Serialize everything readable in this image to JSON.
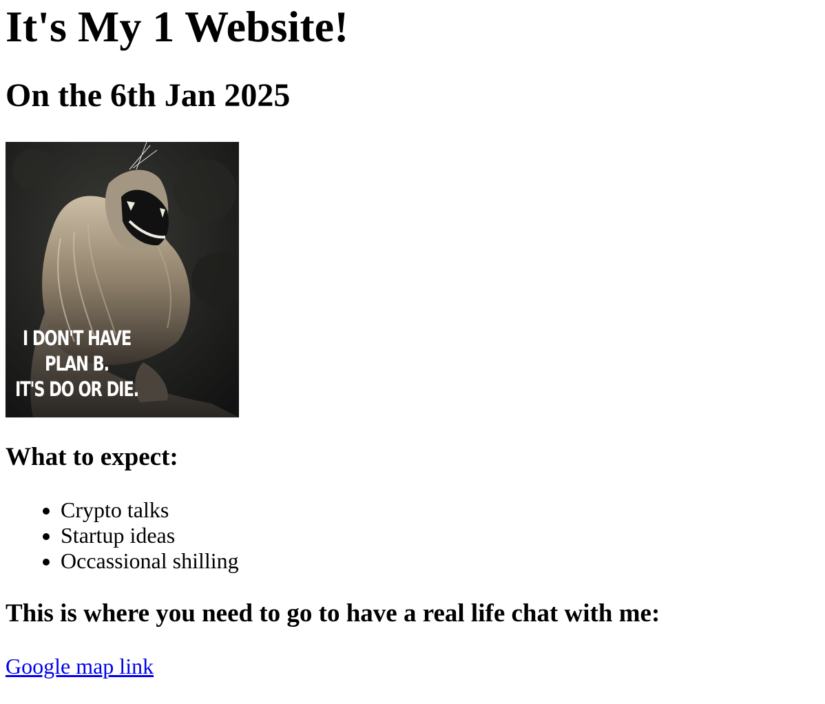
{
  "page": {
    "title": "It's My 1 Website!",
    "date_heading": "On the 6th Jan 2025"
  },
  "poster": {
    "line1": "I DON'T HAVE",
    "line2": "PLAN B.",
    "line3": "IT'S DO OR DIE."
  },
  "expect": {
    "heading": "What to expect:",
    "items": [
      "Crypto talks",
      "Startup ideas",
      "Occassional shilling"
    ]
  },
  "chat": {
    "heading": "This is where you need to go to have a real life chat with me:"
  },
  "link": {
    "label": "Google map link",
    "color": "#0000ee"
  }
}
